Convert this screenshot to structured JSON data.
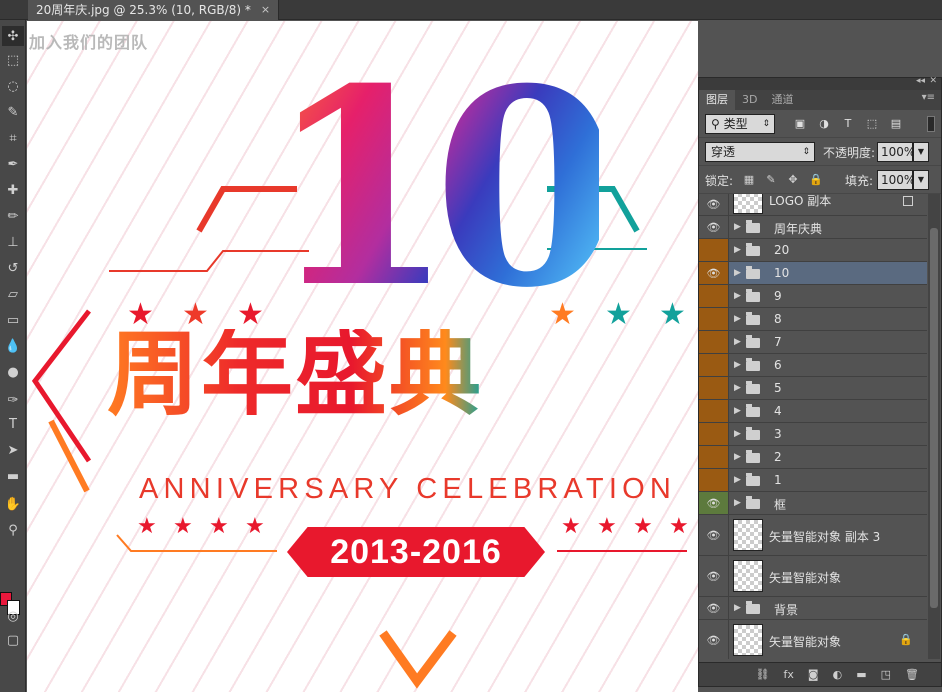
{
  "document_tab": {
    "title": "20周年庆.jpg @ 25.3% (10, RGB/8) *",
    "close": "×"
  },
  "toolbar": {
    "tools": [
      "move-icon",
      "marquee-icon",
      "lasso-icon",
      "quick-select-icon",
      "crop-icon",
      "eyedropper-icon",
      "healing-brush-icon",
      "brush-icon",
      "clone-stamp-icon",
      "history-brush-icon",
      "eraser-icon",
      "gradient-icon",
      "blur-icon",
      "dodge-icon",
      "pen-icon",
      "type-icon",
      "path-select-icon",
      "rectangle-icon",
      "hand-icon",
      "zoom-icon"
    ],
    "type_tool_glyph": "T",
    "foreground_color": "#e8183c",
    "background_color": "#ffffff"
  },
  "canvas": {
    "watermark": "加入我们的团队",
    "big_number": "10",
    "title_cn": "周年盛典",
    "title_en": "ANNIVERSARY CELEBRATION",
    "years": "2013-2016",
    "colors": {
      "primary_red": "#e8182d",
      "orange": "#ff7b22",
      "teal": "#12a19b"
    }
  },
  "layers_panel": {
    "tabs": [
      {
        "label": "图层",
        "active": true
      },
      {
        "label": "3D",
        "active": false
      },
      {
        "label": "通道",
        "active": false
      }
    ],
    "filter": {
      "value": "类型"
    },
    "filter_icons": [
      "image-filter-icon",
      "adjustment-filter-icon",
      "T",
      "shape-filter-icon",
      "smart-object-filter-icon"
    ],
    "blend_mode": "穿透",
    "opacity_label": "不透明度:",
    "opacity_value": "100%",
    "lock_label": "锁定:",
    "fill_label": "填充:",
    "fill_value": "100%",
    "layers": [
      {
        "name": "LOGO 副本",
        "kind": "logo",
        "visible": true
      },
      {
        "name": "周年庆典",
        "kind": "group",
        "visible": true,
        "color": ""
      },
      {
        "name": "20",
        "kind": "group",
        "visible": false,
        "color": "orange"
      },
      {
        "name": "10",
        "kind": "group",
        "visible": true,
        "color": "orange",
        "selected": true
      },
      {
        "name": "9",
        "kind": "group",
        "visible": false,
        "color": "orange"
      },
      {
        "name": "8",
        "kind": "group",
        "visible": false,
        "color": "orange"
      },
      {
        "name": "7",
        "kind": "group",
        "visible": false,
        "color": "orange"
      },
      {
        "name": "6",
        "kind": "group",
        "visible": false,
        "color": "orange"
      },
      {
        "name": "5",
        "kind": "group",
        "visible": false,
        "color": "orange"
      },
      {
        "name": "4",
        "kind": "group",
        "visible": false,
        "color": "orange"
      },
      {
        "name": "3",
        "kind": "group",
        "visible": false,
        "color": "orange"
      },
      {
        "name": "2",
        "kind": "group",
        "visible": false,
        "color": "orange"
      },
      {
        "name": "1",
        "kind": "group",
        "visible": false,
        "color": "orange"
      },
      {
        "name": "框",
        "kind": "group",
        "visible": true,
        "color": "green"
      },
      {
        "name": "矢量智能对象 副本 3",
        "kind": "smart",
        "visible": true
      },
      {
        "name": "矢量智能对象",
        "kind": "smart",
        "visible": true
      },
      {
        "name": "背景",
        "kind": "group",
        "visible": true,
        "color": ""
      },
      {
        "name": "矢量智能对象",
        "kind": "smart",
        "visible": true,
        "locked": true
      }
    ],
    "bottom_icons": [
      "link-icon",
      "fx",
      "mask-icon",
      "adjustment-icon",
      "new-group-icon",
      "new-layer-icon",
      "trash-icon"
    ],
    "bottom_fx_label": "fx"
  }
}
